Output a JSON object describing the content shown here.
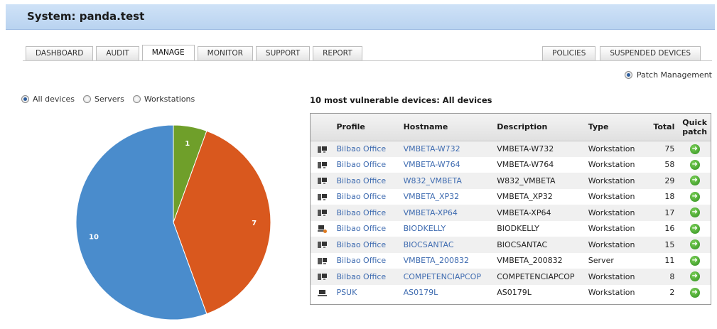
{
  "window": {
    "title": "System: panda.test"
  },
  "tabs_left": [
    {
      "label": "DASHBOARD",
      "active": false
    },
    {
      "label": "AUDIT",
      "active": false
    },
    {
      "label": "MANAGE",
      "active": true
    },
    {
      "label": "MONITOR",
      "active": false
    },
    {
      "label": "SUPPORT",
      "active": false
    },
    {
      "label": "REPORT",
      "active": false
    }
  ],
  "tabs_right": [
    {
      "label": "POLICIES"
    },
    {
      "label": "SUSPENDED DEVICES"
    }
  ],
  "patch_option": {
    "label": "Patch Management",
    "selected": true
  },
  "device_filter": [
    {
      "label": "All devices",
      "selected": true
    },
    {
      "label": "Servers",
      "selected": false
    },
    {
      "label": "Workstations",
      "selected": false
    }
  ],
  "chart_data": {
    "type": "pie",
    "values": [
      1,
      7,
      10
    ],
    "colors": [
      "#6f9f2a",
      "#d9581e",
      "#4a8ccc"
    ]
  },
  "table": {
    "title": "10 most vulnerable devices: All devices",
    "headers": {
      "profile": "Profile",
      "hostname": "Hostname",
      "description": "Description",
      "type": "Type",
      "total": "Total",
      "quick": "Quick patch"
    },
    "rows": [
      {
        "icon": "workstation-icon",
        "profile": "Bilbao Office",
        "hostname": "VMBETA-W732",
        "description": "VMBETA-W732",
        "type": "Workstation",
        "total": "75"
      },
      {
        "icon": "workstation-icon",
        "profile": "Bilbao Office",
        "hostname": "VMBETA-W764",
        "description": "VMBETA-W764",
        "type": "Workstation",
        "total": "58"
      },
      {
        "icon": "workstation-icon",
        "profile": "Bilbao Office",
        "hostname": "W832_VMBETA",
        "description": "W832_VMBETA",
        "type": "Workstation",
        "total": "29"
      },
      {
        "icon": "workstation-icon",
        "profile": "Bilbao Office",
        "hostname": "VMBETA_XP32",
        "description": "VMBETA_XP32",
        "type": "Workstation",
        "total": "18"
      },
      {
        "icon": "workstation-icon",
        "profile": "Bilbao Office",
        "hostname": "VMBETA-XP64",
        "description": "VMBETA-XP64",
        "type": "Workstation",
        "total": "17"
      },
      {
        "icon": "laptop-warning-icon",
        "profile": "Bilbao Office",
        "hostname": "BIODKELLY",
        "description": "BIODKELLY",
        "type": "Workstation",
        "total": "16"
      },
      {
        "icon": "workstation-icon",
        "profile": "Bilbao Office",
        "hostname": "BIOCSANTAC",
        "description": "BIOCSANTAC",
        "type": "Workstation",
        "total": "15"
      },
      {
        "icon": "server-icon",
        "profile": "Bilbao Office",
        "hostname": "VMBETA_200832",
        "description": "VMBETA_200832",
        "type": "Server",
        "total": "11"
      },
      {
        "icon": "workstation-icon",
        "profile": "Bilbao Office",
        "hostname": "COMPETENCIAPCOP",
        "description": "COMPETENCIAPCOP",
        "type": "Workstation",
        "total": "8"
      },
      {
        "icon": "laptop-icon",
        "profile": "PSUK",
        "hostname": "AS0179L",
        "description": "AS0179L",
        "type": "Workstation",
        "total": "2"
      }
    ]
  }
}
